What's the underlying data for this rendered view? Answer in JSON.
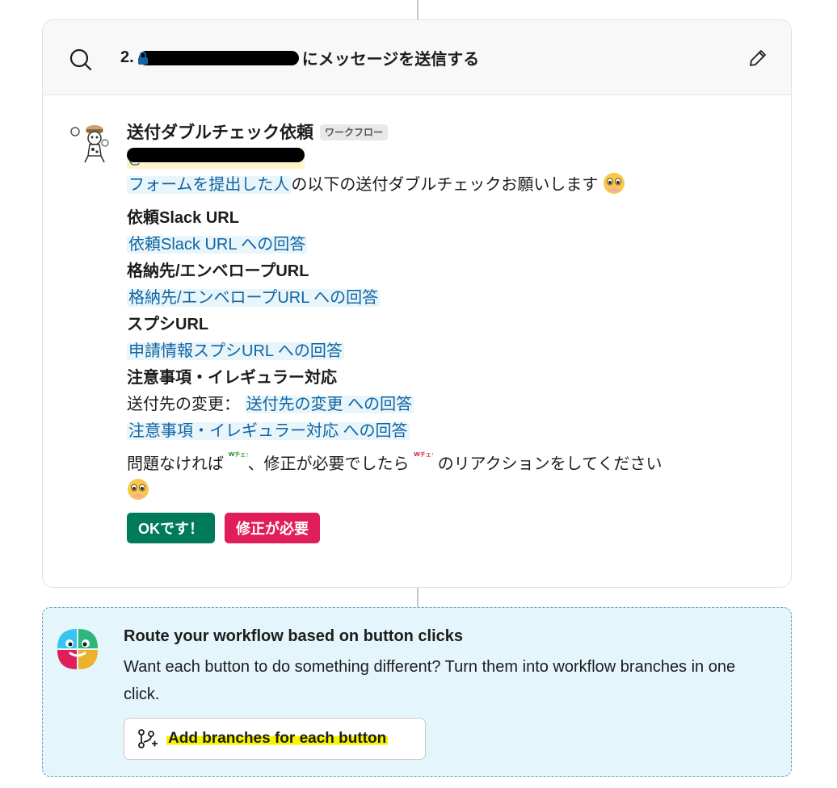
{
  "step": {
    "number_prefix": "2.",
    "title_suffix": "にメッセージを送信する"
  },
  "message": {
    "sender": "送付ダブルチェック依頼",
    "badge": "ワークフロー",
    "mention_prefix": "@",
    "intro_link": "フォームを提出した人",
    "intro_text": "の以下の送付ダブルチェックお願いします",
    "fields": [
      {
        "label": "依頼Slack URL",
        "answer": "依頼Slack URL への回答"
      },
      {
        "label": "格納先/エンベロープURL",
        "answer": "格納先/エンベロープURL への回答"
      },
      {
        "label": "スプシURL",
        "answer": "申請情報スプシURL への回答"
      }
    ],
    "notes_label": "注意事項・イレギュラー対応",
    "dest_change_prefix": "送付先の変更：",
    "dest_change_answer": "送付先の変更 への回答",
    "notes_answer": "注意事項・イレギュラー対応 への回答",
    "reaction_text_1": "問題なければ",
    "reaction_text_2": "、修正が必要でしたら",
    "reaction_text_3": "のリアクションをしてください",
    "emoji_ok_text": "Wチェック OKです！",
    "emoji_fix_text": "Wチェック 修正お願い",
    "buttons": {
      "ok": "OKです！",
      "fix": "修正が必要"
    }
  },
  "tip": {
    "title": "Route your workflow based on button clicks",
    "description": "Want each button to do something different? Turn them into workflow branches in one click.",
    "button_label": "Add branches for each button"
  },
  "colors": {
    "ok_button": "#007a5a",
    "fix_button": "#e01e5a",
    "link": "#1264a3",
    "tip_background": "#e4f6fc",
    "highlight": "#f6f400"
  }
}
